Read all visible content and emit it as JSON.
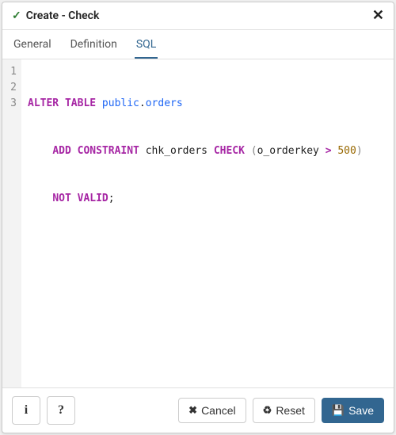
{
  "titlebar": {
    "icon": "✓",
    "title": "Create - Check",
    "close": "✕"
  },
  "tabs": [
    {
      "label": "General",
      "active": false
    },
    {
      "label": "Definition",
      "active": false
    },
    {
      "label": "SQL",
      "active": true
    }
  ],
  "code": {
    "lines": [
      "1",
      "2",
      "3"
    ],
    "tokens": {
      "l1_kw1": "ALTER TABLE",
      "l1_id1": "public",
      "l1_dot": ".",
      "l1_id2": "orders",
      "l2_indent": "    ",
      "l2_kw1": "ADD CONSTRAINT",
      "l2_tx1": " chk_orders ",
      "l2_kw2": "CHECK",
      "l2_sp": " ",
      "l2_p1": "(",
      "l2_tx2": "o_orderkey ",
      "l2_op": ">",
      "l2_sp2": " ",
      "l2_num": "500",
      "l2_p2": ")",
      "l3_indent": "    ",
      "l3_kw1": "NOT VALID",
      "l3_semi": ";"
    }
  },
  "footer": {
    "info": "i",
    "help": "?",
    "cancel_icon": "✖",
    "cancel_label": "Cancel",
    "reset_icon": "♻",
    "reset_label": "Reset",
    "save_icon": "💾",
    "save_label": "Save"
  }
}
